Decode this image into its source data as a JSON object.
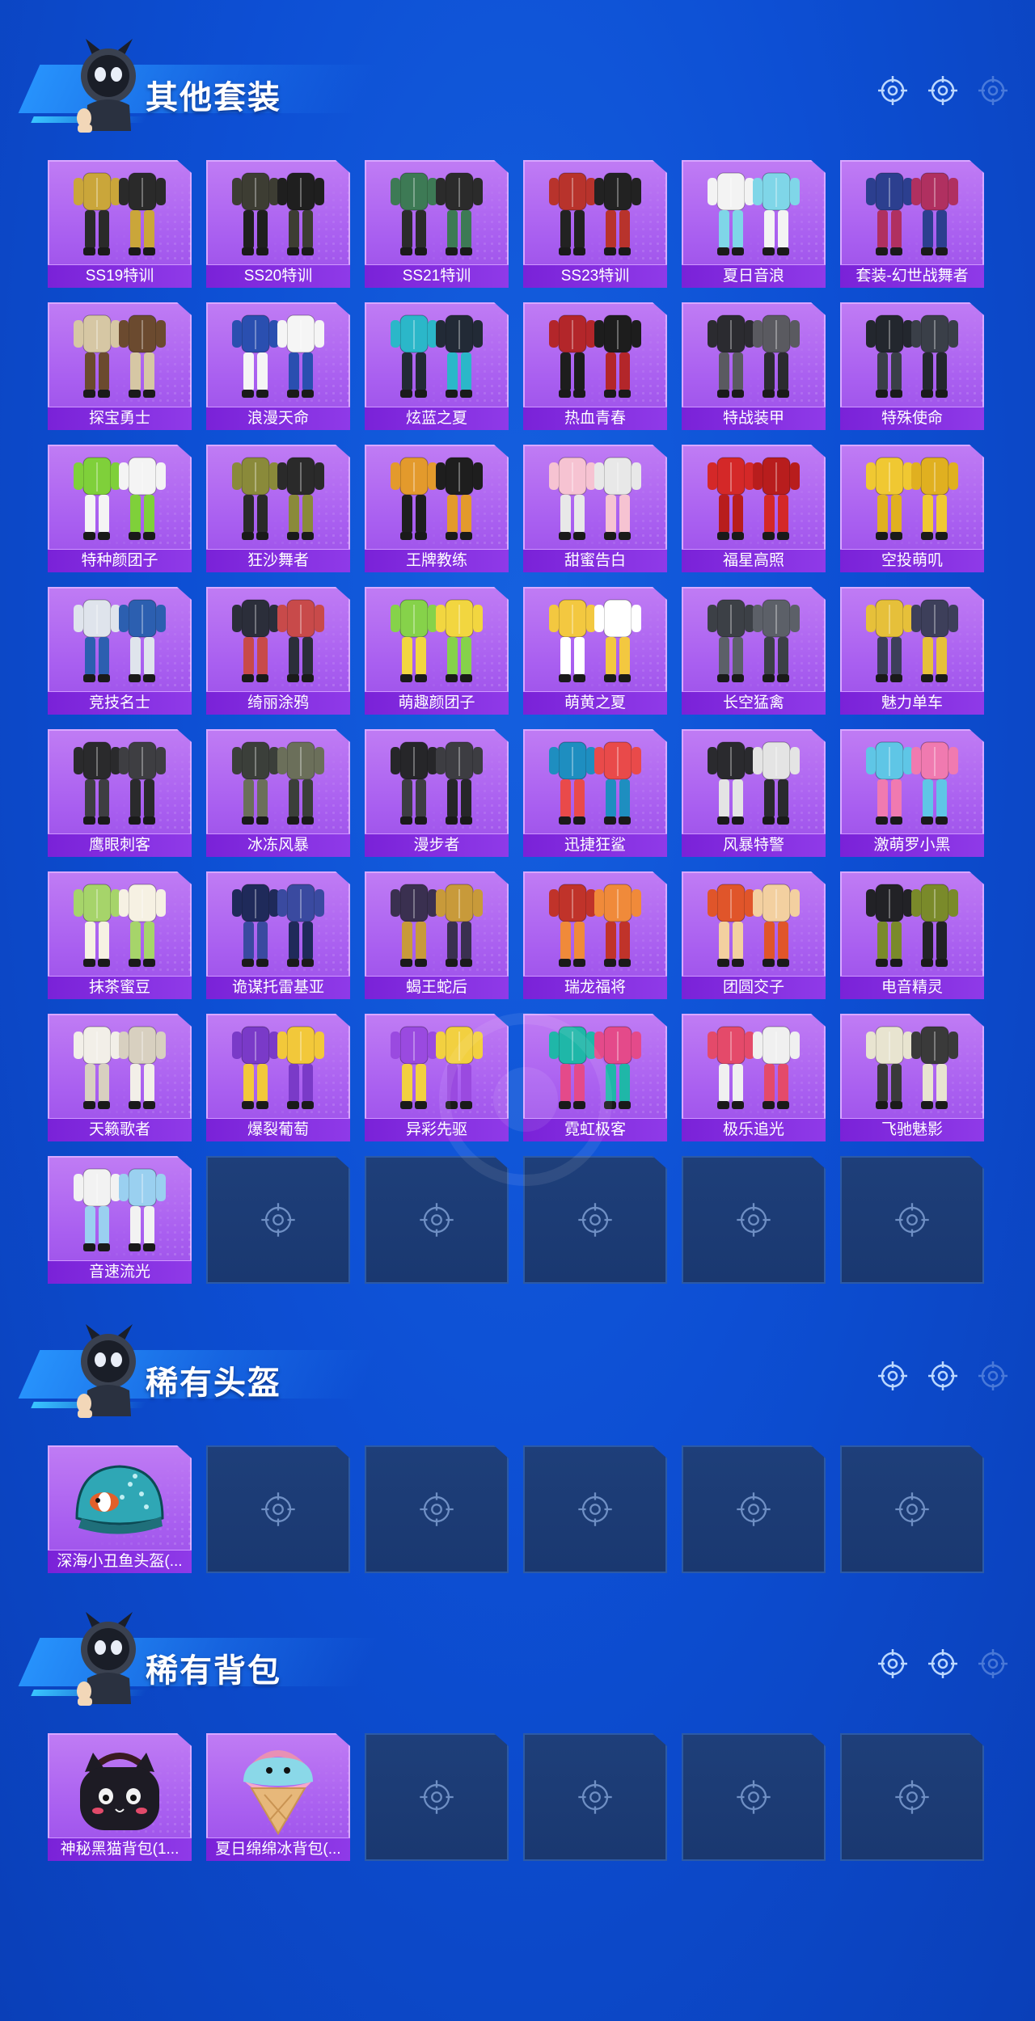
{
  "sections": [
    {
      "title": "其他套装",
      "items": [
        {
          "label": "SS19特训",
          "art": "outfit",
          "colors": [
            "#caa63a",
            "#2a2a2a"
          ]
        },
        {
          "label": "SS20特训",
          "art": "outfit",
          "colors": [
            "#3d3d33",
            "#1f1f1f"
          ]
        },
        {
          "label": "SS21特训",
          "art": "outfit",
          "colors": [
            "#3d7a55",
            "#2b2b2b"
          ]
        },
        {
          "label": "SS23特训",
          "art": "outfit",
          "colors": [
            "#b8332c",
            "#222222"
          ]
        },
        {
          "label": "夏日音浪",
          "art": "outfit",
          "colors": [
            "#f3f3f3",
            "#7fd6e8"
          ]
        },
        {
          "label": "套装-幻世战舞者",
          "art": "outfit",
          "colors": [
            "#2c3f8f",
            "#b03060"
          ]
        },
        {
          "label": "探宝勇士",
          "art": "outfit",
          "colors": [
            "#d6c7a4",
            "#6b4a2f"
          ]
        },
        {
          "label": "浪漫天命",
          "art": "outfit",
          "colors": [
            "#2a4fb0",
            "#f5f5f5"
          ]
        },
        {
          "label": "炫蓝之夏",
          "art": "outfit",
          "colors": [
            "#2bb7c9",
            "#222a36"
          ]
        },
        {
          "label": "热血青春",
          "art": "outfit",
          "colors": [
            "#b3262a",
            "#1d1d1d"
          ]
        },
        {
          "label": "特战装甲",
          "art": "outfit",
          "colors": [
            "#2b2b30",
            "#5a5a60"
          ]
        },
        {
          "label": "特殊使命",
          "art": "outfit",
          "colors": [
            "#23272e",
            "#3a3f48"
          ]
        },
        {
          "label": "特种颜团子",
          "art": "outfit",
          "colors": [
            "#7fd03a",
            "#f4f4f4"
          ]
        },
        {
          "label": "狂沙舞者",
          "art": "outfit",
          "colors": [
            "#8a8a3a",
            "#2a2a2a"
          ]
        },
        {
          "label": "王牌教练",
          "art": "outfit",
          "colors": [
            "#e39a2c",
            "#1e1e1e"
          ]
        },
        {
          "label": "甜蜜告白",
          "art": "outfit",
          "colors": [
            "#f6c3d2",
            "#e8e8e8"
          ]
        },
        {
          "label": "福星高照",
          "art": "outfit",
          "colors": [
            "#d42828",
            "#b81d1d"
          ]
        },
        {
          "label": "空投萌叽",
          "art": "outfit",
          "colors": [
            "#f0c832",
            "#e0b020"
          ]
        },
        {
          "label": "竞技名士",
          "art": "outfit",
          "colors": [
            "#dfe4ec",
            "#2c5fb0"
          ]
        },
        {
          "label": "绮丽涂鸦",
          "art": "outfit",
          "colors": [
            "#2b2e3a",
            "#c84a4a"
          ]
        },
        {
          "label": "萌趣颜团子",
          "art": "outfit",
          "colors": [
            "#86d24a",
            "#f2d640"
          ]
        },
        {
          "label": "萌黄之夏",
          "art": "outfit",
          "colors": [
            "#f3c840",
            "#ffffff"
          ]
        },
        {
          "label": "长空猛禽",
          "art": "outfit",
          "colors": [
            "#3c4046",
            "#5c6068"
          ]
        },
        {
          "label": "魅力单车",
          "art": "outfit",
          "colors": [
            "#e6c03a",
            "#3d3f5a"
          ]
        },
        {
          "label": "鹰眼刺客",
          "art": "outfit",
          "colors": [
            "#2a2a2c",
            "#3e3e42"
          ]
        },
        {
          "label": "冰冻风暴",
          "art": "outfit",
          "colors": [
            "#3b3f3a",
            "#6b6f5a"
          ]
        },
        {
          "label": "漫步者",
          "art": "outfit",
          "colors": [
            "#262629",
            "#3d3d42"
          ]
        },
        {
          "label": "迅捷狂鲨",
          "art": "outfit",
          "colors": [
            "#1e8ec0",
            "#e94a4a"
          ]
        },
        {
          "label": "风暴特警",
          "art": "outfit",
          "colors": [
            "#2a2a2e",
            "#e4e4e4"
          ]
        },
        {
          "label": "激萌罗小黑",
          "art": "outfit",
          "colors": [
            "#5fc6e6",
            "#f07ab0"
          ]
        },
        {
          "label": "抹茶蜜豆",
          "art": "outfit",
          "colors": [
            "#a6d46a",
            "#f6f1e3"
          ]
        },
        {
          "label": "诡谋托雷基亚",
          "art": "outfit",
          "colors": [
            "#1f2a5a",
            "#3a4aa0"
          ]
        },
        {
          "label": "蝎王蛇后",
          "art": "outfit",
          "colors": [
            "#3a3050",
            "#c89a3a"
          ]
        },
        {
          "label": "瑞龙福将",
          "art": "outfit",
          "colors": [
            "#c0332a",
            "#f08a3a"
          ]
        },
        {
          "label": "团圆交子",
          "art": "outfit",
          "colors": [
            "#e0552a",
            "#f3d0a0"
          ]
        },
        {
          "label": "电音精灵",
          "art": "outfit",
          "colors": [
            "#222226",
            "#7a8a2a"
          ]
        },
        {
          "label": "天籁歌者",
          "art": "outfit",
          "colors": [
            "#f2efe8",
            "#d8d0c0"
          ]
        },
        {
          "label": "爆裂葡萄",
          "art": "outfit",
          "colors": [
            "#7a3ac8",
            "#f2c83a"
          ]
        },
        {
          "label": "异彩先驱",
          "art": "outfit",
          "colors": [
            "#9a4ae0",
            "#f2d040"
          ]
        },
        {
          "label": "霓虹极客",
          "art": "outfit",
          "colors": [
            "#1fb7a8",
            "#e44a8a"
          ]
        },
        {
          "label": "极乐追光",
          "art": "outfit",
          "colors": [
            "#e44a6a",
            "#f0f0f0"
          ]
        },
        {
          "label": "飞驰魅影",
          "art": "outfit",
          "colors": [
            "#e8e4d0",
            "#3a3a3a"
          ]
        },
        {
          "label": "音速流光",
          "art": "outfit",
          "colors": [
            "#f2f2f2",
            "#9ad0f0"
          ]
        },
        null,
        null,
        null,
        null,
        null
      ]
    },
    {
      "title": "稀有头盔",
      "items": [
        {
          "label": "深海小丑鱼头盔(...",
          "art": "helmet",
          "colors": [
            "#2fa7b5",
            "#e2602a"
          ]
        },
        null,
        null,
        null,
        null,
        null
      ]
    },
    {
      "title": "稀有背包",
      "items": [
        {
          "label": "神秘黑猫背包(1...",
          "art": "backpack-cat",
          "colors": [
            "#1d1b24",
            "#e24a6a"
          ]
        },
        {
          "label": "夏日绵绵冰背包(...",
          "art": "backpack-ice",
          "colors": [
            "#f6a8c8",
            "#8ad8e8"
          ]
        },
        null,
        null,
        null,
        null
      ]
    }
  ],
  "icons": {
    "placeholder": "crosshair-icon",
    "header_deco": "crosshair-icon",
    "mascot": "mascot-icon"
  },
  "theme": {
    "background": "#0d4fd4",
    "card_purple": "#a95ff0",
    "label_purple": "#7a22d8",
    "empty_slot": "#1e3f7a"
  }
}
